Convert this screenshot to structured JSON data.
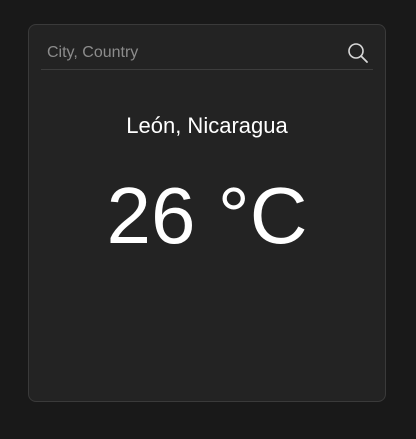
{
  "search": {
    "placeholder": "City, Country",
    "value": "",
    "icon": "search-icon"
  },
  "weather": {
    "location": "León, Nicaragua",
    "temperature": "26 °C"
  },
  "colors": {
    "background": "#191919",
    "card": "#232323",
    "text": "#ffffff",
    "placeholder": "#8c8c8c"
  }
}
